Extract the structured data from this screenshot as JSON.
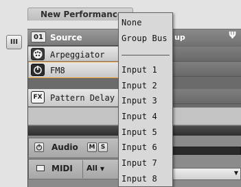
{
  "tab": {
    "title": "New Performance"
  },
  "side_button": {
    "glyph": "III"
  },
  "header": {
    "slot_number": "01",
    "title": "Source",
    "right_fragment": "up",
    "routing_glyph": "Ψ"
  },
  "modules": [
    {
      "label": "Arpeggiator",
      "icon": "arpeggiator-icon"
    },
    {
      "label": "FM8",
      "icon": "fm8-power-icon"
    },
    {
      "label": "Pattern Delay",
      "icon": "fx-icon",
      "icon_text": "FX"
    }
  ],
  "io": {
    "audio_label": "Audio",
    "audio_mute": "M",
    "audio_solo": "S",
    "midi_label": "MIDI",
    "midi_channel": "All"
  },
  "menu": {
    "items_top": [
      "None",
      "Group Bus"
    ],
    "inputs": [
      "Input 1",
      "Input 2",
      "Input 3",
      "Input 4",
      "Input 5",
      "Input 6",
      "Input 7",
      "Input 8"
    ]
  },
  "colors": {
    "accent_orange": "#f0a030",
    "menu_bg": "#d8d8d8",
    "panel_bg": "#6b6b6b"
  }
}
